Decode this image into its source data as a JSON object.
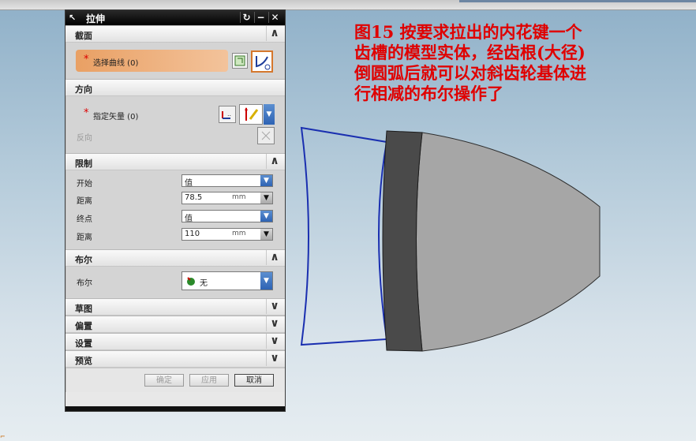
{
  "dialog": {
    "title": "拉伸",
    "sections": {
      "section_title": "截面",
      "select_curve_label": "选择曲线 (0)",
      "direction_title": "方向",
      "specify_vector_label": "指定矢量 (0)",
      "reverse_label": "反向",
      "limits_title": "限制",
      "start_label": "开始",
      "start_value": "值",
      "distance_label": "距离",
      "distance1_value": "78.5",
      "distance_unit": "mm",
      "end_label": "终点",
      "end_value": "值",
      "distance2_value": "110",
      "boolean_title": "布尔",
      "boolean_label": "布尔",
      "boolean_value": "无",
      "draft_title": "草图",
      "offset_title": "偏置",
      "settings_title": "设置",
      "preview_title": "预览"
    },
    "buttons": {
      "ok": "确定",
      "apply": "应用",
      "cancel": "取消"
    }
  },
  "annotation": {
    "line1": "图15   按要求拉出的内花键一个",
    "line2": "齿槽的模型实体，经齿根(大径)",
    "line3": "倒圆弧后就可以对斜齿轮基体进",
    "line4": "行相减的布尔操作了"
  },
  "colors": {
    "annotation_red": "#e00000",
    "outline_blue": "#1a2fb0",
    "solid_dark": "#4a4a4a",
    "solid_light": "#a6a6a6"
  }
}
